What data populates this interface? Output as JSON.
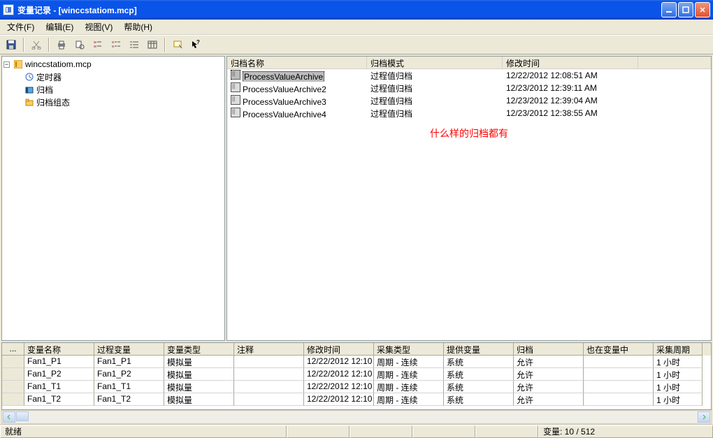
{
  "title": "变量记录 - [winccstatiom.mcp]",
  "menu": {
    "file": "文件(F)",
    "edit": "编辑(E)",
    "view": "视图(V)",
    "help": "帮助(H)"
  },
  "tree": {
    "root": "winccstatiom.mcp",
    "timer": "定时器",
    "archive": "归档",
    "archcfg": "归档组态"
  },
  "archiveList": {
    "headers": {
      "name": "归档名称",
      "mode": "归档模式",
      "modified": "修改时间"
    },
    "rows": [
      {
        "name": "ProcessValueArchive",
        "mode": "过程值归档",
        "modified": "12/22/2012 12:08:51 AM"
      },
      {
        "name": "ProcessValueArchive2",
        "mode": "过程值归档",
        "modified": "12/23/2012 12:39:11 AM"
      },
      {
        "name": "ProcessValueArchive3",
        "mode": "过程值归档",
        "modified": "12/23/2012 12:39:04 AM"
      },
      {
        "name": "ProcessValueArchive4",
        "mode": "过程值归档",
        "modified": "12/23/2012 12:38:55 AM"
      }
    ],
    "note": "什么样的归档都有"
  },
  "tagGrid": {
    "headers": {
      "rowhdr": "...",
      "name": "变量名称",
      "proc": "过程变量",
      "type": "变量类型",
      "comment": "注释",
      "modified": "修改时间",
      "acq": "采集类型",
      "supply": "提供变量",
      "arch": "归档",
      "also": "也在变量中",
      "cycle": "采集周期"
    },
    "rows": [
      {
        "name": "Fan1_P1",
        "proc": "Fan1_P1",
        "type": "模拟量",
        "comment": "",
        "modified": "12/22/2012 12:10",
        "acq": "周期 - 连续",
        "supply": "系统",
        "arch": "允许",
        "also": "",
        "cycle": "1 小时"
      },
      {
        "name": "Fan1_P2",
        "proc": "Fan1_P2",
        "type": "模拟量",
        "comment": "",
        "modified": "12/22/2012 12:10",
        "acq": "周期 - 连续",
        "supply": "系统",
        "arch": "允许",
        "also": "",
        "cycle": "1 小时"
      },
      {
        "name": "Fan1_T1",
        "proc": "Fan1_T1",
        "type": "模拟量",
        "comment": "",
        "modified": "12/22/2012 12:10",
        "acq": "周期 - 连续",
        "supply": "系统",
        "arch": "允许",
        "also": "",
        "cycle": "1 小时"
      },
      {
        "name": "Fan1_T2",
        "proc": "Fan1_T2",
        "type": "模拟量",
        "comment": "",
        "modified": "12/22/2012 12:10",
        "acq": "周期 - 连续",
        "supply": "系统",
        "arch": "允许",
        "also": "",
        "cycle": "1 小时"
      }
    ]
  },
  "status": {
    "ready": "就绪",
    "vars": "变量: 10 / 512"
  }
}
